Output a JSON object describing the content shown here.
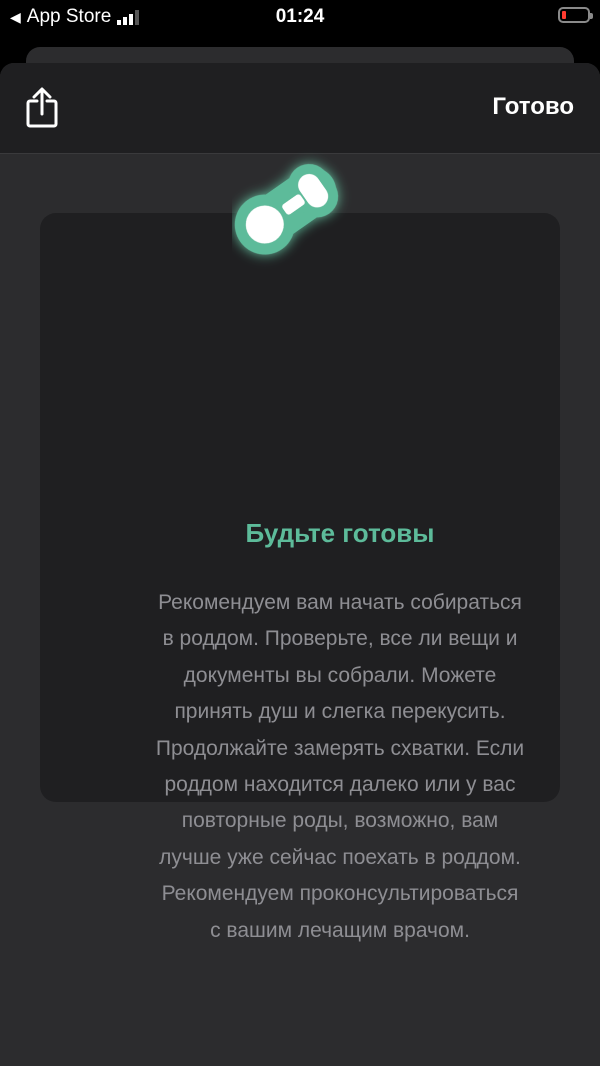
{
  "status_bar": {
    "back_app": "App Store",
    "time": "01:24"
  },
  "nav": {
    "share_icon": "share-icon",
    "done_label": "Готово"
  },
  "card": {
    "icon": "pacifier-icon",
    "accent_color": "#5dbb9a",
    "title": "Будьте готовы",
    "body_lines": [
      "Рекомендуем вам начать собираться",
      "в роддом. Проверьте, все ли вещи и",
      "документы вы собрали. Можете",
      "принять душ и слегка перекусить.",
      "Продолжайте замерять схватки. Если",
      "роддом находится далеко или у вас",
      "повторные роды, возможно, вам",
      "лучше уже сейчас поехать в роддом.",
      "Рекомендуем проконсультироваться",
      "с вашим лечащим врачом."
    ]
  }
}
